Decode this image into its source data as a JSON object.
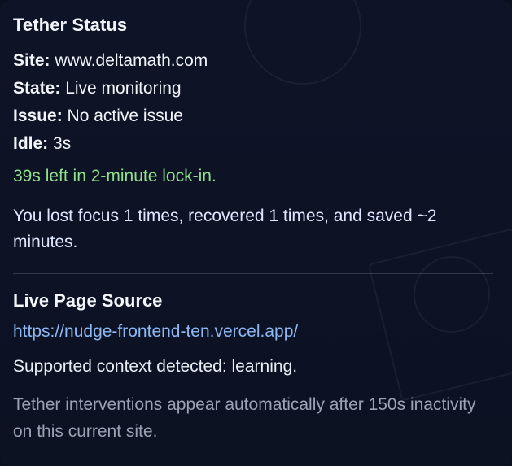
{
  "status": {
    "title": "Tether Status",
    "site_label": "Site:",
    "site_value": "www.deltamath.com",
    "state_label": "State:",
    "state_value": "Live monitoring",
    "issue_label": "Issue:",
    "issue_value": "No active issue",
    "idle_label": "Idle:",
    "idle_value": "3s",
    "lockin_text": "39s left in 2-minute lock-in.",
    "summary_text": "You lost focus 1 times, recovered 1 times, and saved ~2 minutes."
  },
  "source": {
    "title": "Live Page Source",
    "url": "https://nudge-frontend-ten.vercel.app/",
    "detected_text": "Supported context detected: learning.",
    "note_text": "Tether interventions appear automatically after 150s inactivity on this current site."
  },
  "colors": {
    "background": "#0e1427",
    "text": "#f3f5fa",
    "lockin": "#8fe08a",
    "link": "#8db8f2",
    "muted": "#9aa3b5"
  }
}
